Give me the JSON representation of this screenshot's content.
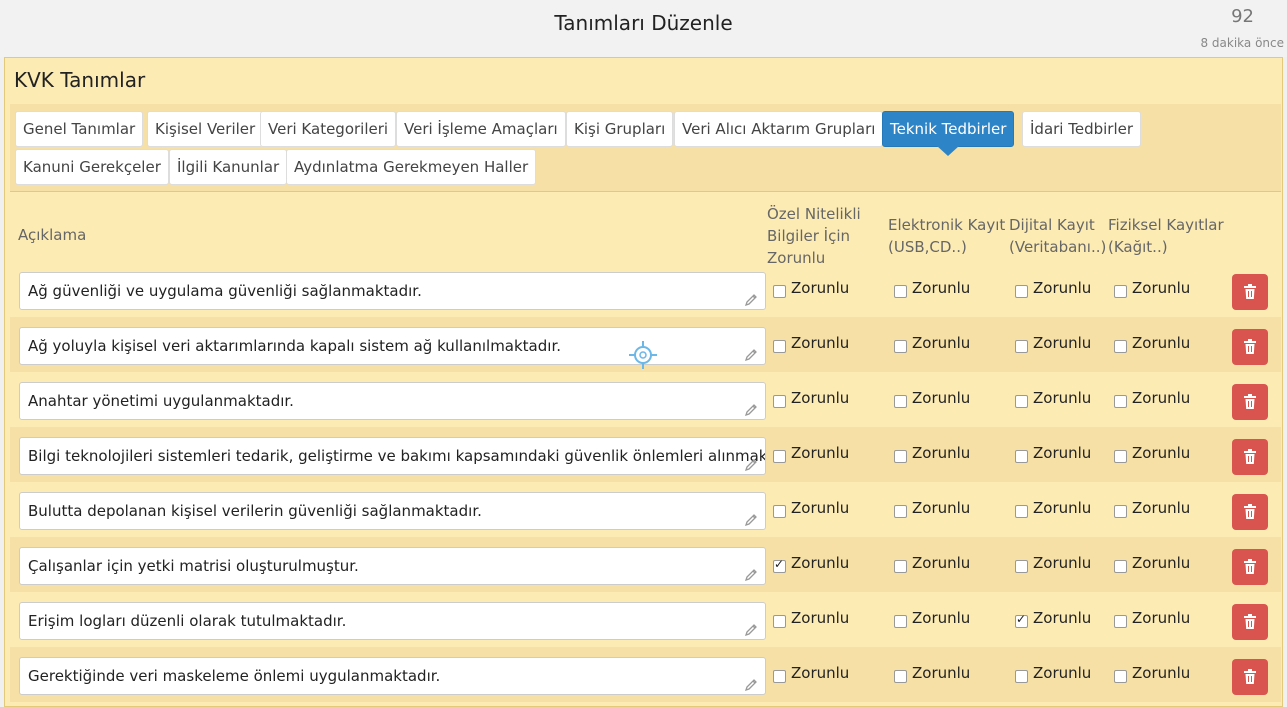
{
  "topbar": {
    "title": "Tanımları Düzenle",
    "counter": "92",
    "ago": "8 dakika önce"
  },
  "panel": {
    "title": "KVK Tanımlar"
  },
  "tabs": [
    {
      "label": "Genel Tanımlar"
    },
    {
      "label": "Kişisel Veriler"
    },
    {
      "label": "Veri Kategorileri"
    },
    {
      "label": "Veri İşleme Amaçları"
    },
    {
      "label": "Kişi Grupları"
    },
    {
      "label": "Veri Alıcı Aktarım Grupları"
    },
    {
      "label": "Teknik Tedbirler"
    },
    {
      "label": "İdari Tedbirler"
    },
    {
      "label": "Kanuni Gerekçeler"
    },
    {
      "label": "İlgili Kanunlar"
    },
    {
      "label": "Aydınlatma Gerekmeyen Haller"
    }
  ],
  "active_tab": "Teknik Tedbirler",
  "headers": {
    "aciklama": "Açıklama",
    "ozel": [
      "Özel Nitelikli",
      "Bilgiler İçin",
      "Zorunlu"
    ],
    "elektronik": [
      "Elektronik Kayıt",
      "(USB,CD..)"
    ],
    "dijital": [
      "Dijital Kayıt",
      "(Veritabanı..)"
    ],
    "fiziksel": [
      "Fiziksel Kayıtlar",
      "(Kağıt..)"
    ]
  },
  "checkbox_label": "Zorunlu",
  "rows": [
    {
      "text": "Ağ güvenliği ve uygulama güvenliği sağlanmaktadır.",
      "ozel": false,
      "elektronik": false,
      "dijital": false,
      "fiziksel": false
    },
    {
      "text": "Ağ yoluyla kişisel veri aktarımlarında kapalı sistem ağ kullanılmaktadır.",
      "ozel": false,
      "elektronik": false,
      "dijital": false,
      "fiziksel": false
    },
    {
      "text": "Anahtar yönetimi uygulanmaktadır.",
      "ozel": false,
      "elektronik": false,
      "dijital": false,
      "fiziksel": false
    },
    {
      "text": "Bilgi teknolojileri sistemleri tedarik, geliştirme ve bakımı kapsamındaki güvenlik önlemleri alınmaktadır.",
      "ozel": false,
      "elektronik": false,
      "dijital": false,
      "fiziksel": false
    },
    {
      "text": "Bulutta depolanan kişisel verilerin güvenliği sağlanmaktadır.",
      "ozel": false,
      "elektronik": false,
      "dijital": false,
      "fiziksel": false
    },
    {
      "text": "Çalışanlar için yetki matrisi oluşturulmuştur.",
      "ozel": true,
      "elektronik": false,
      "dijital": false,
      "fiziksel": false
    },
    {
      "text": "Erişim logları düzenli olarak tutulmaktadır.",
      "ozel": false,
      "elektronik": false,
      "dijital": true,
      "fiziksel": false
    },
    {
      "text": "Gerektiğinde veri maskeleme önlemi uygulanmaktadır.",
      "ozel": false,
      "elektronik": false,
      "dijital": false,
      "fiziksel": false
    }
  ],
  "colors": {
    "accent": "#2d85c8",
    "panel_bg": "#fdebb4",
    "delete": "#d9534f"
  },
  "icons": {
    "edit": "pencil-icon",
    "delete": "trash-icon",
    "cursor": "crosshair-icon"
  }
}
